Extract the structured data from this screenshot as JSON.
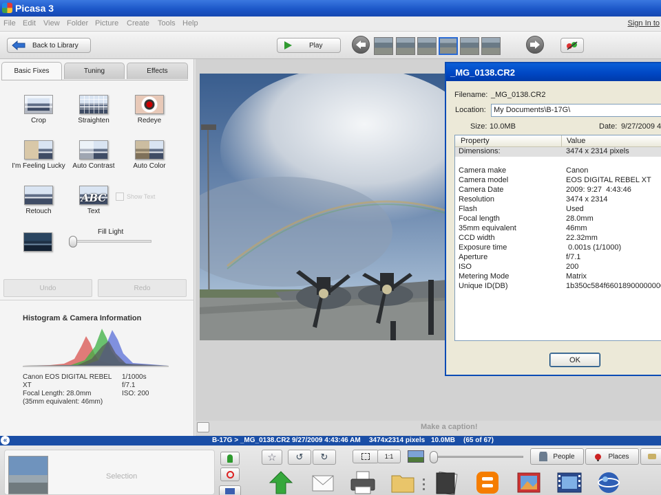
{
  "window": {
    "title": "Picasa 3"
  },
  "menu": [
    "File",
    "Edit",
    "View",
    "Folder",
    "Picture",
    "Create",
    "Tools",
    "Help"
  ],
  "signin": "Sign In to",
  "toolbar": {
    "back_label": "Back to Library",
    "play_label": "Play"
  },
  "tabs": [
    "Basic Fixes",
    "Tuning",
    "Effects"
  ],
  "tools": [
    "Crop",
    "Straighten",
    "Redeye",
    "I'm Feeling Lucky",
    "Auto Contrast",
    "Auto Color",
    "Retouch",
    "Text"
  ],
  "text_icon": "ABC",
  "show_text": "Show Text",
  "fill_light": {
    "label": "Fill Light",
    "level": 0
  },
  "undo": "Undo",
  "redo": "Redo",
  "histogram_title": "Histogram & Camera Information",
  "camera_info": {
    "model_l1": "Canon EOS DIGITAL REBEL",
    "model_l2": "XT",
    "focal": "Focal Length: 28.0mm",
    "equiv": "(35mm equivalent:  46mm)",
    "shutter": "1/1000s",
    "aperture": "f/7.1",
    "iso": "ISO: 200"
  },
  "caption": "Make a caption!",
  "info_bar": {
    "path": "B-17G > _MG_0138.CR2",
    "date": "9/27/2009 4:43:46 AM",
    "dims": "3474x2314 pixels",
    "size": "10.0MB",
    "count": "(65 of 67)"
  },
  "dialog": {
    "title": "_MG_0138.CR2",
    "filename_label": "Filename:",
    "filename_value": "_MG_0138.CR2",
    "location_label": "Location:",
    "location_value": "My Documents\\B-17G\\",
    "size_label": "Size:",
    "size_value": "10.0MB",
    "date_label": "Date:",
    "date_value": "9/27/2009 4",
    "col_property": "Property",
    "col_value": "Value",
    "rows": [
      {
        "p": "Dimensions:",
        "v": "3474 x 2314 pixels"
      },
      {
        "p": "",
        "v": ""
      },
      {
        "p": "Camera make",
        "v": "Canon"
      },
      {
        "p": "Camera model",
        "v": "EOS DIGITAL REBEL XT"
      },
      {
        "p": "Camera Date",
        "v": "2009: 9:27  4:43:46"
      },
      {
        "p": "Resolution",
        "v": "3474 x 2314"
      },
      {
        "p": "Flash",
        "v": "Used"
      },
      {
        "p": "Focal length",
        "v": "28.0mm"
      },
      {
        "p": "35mm equivalent",
        "v": "46mm"
      },
      {
        "p": "CCD width",
        "v": "22.32mm"
      },
      {
        "p": "Exposure time",
        "v": " 0.001s (1/1000)"
      },
      {
        "p": "Aperture",
        "v": "f/7.1"
      },
      {
        "p": "ISO",
        "v": "200"
      },
      {
        "p": "Metering Mode",
        "v": "Matrix"
      },
      {
        "p": "Unique ID(DB)",
        "v": "1b350c584f660189000000000"
      }
    ],
    "ok_label": "OK"
  },
  "bottom": {
    "selection_label": "Selection",
    "people_label": "People",
    "places_label": "Places",
    "zoom_label": "1:1"
  },
  "colors": {
    "accent": "#1a4ea6",
    "title_bar": "#1c57c8",
    "dialog_border": "#0a4bb5"
  }
}
